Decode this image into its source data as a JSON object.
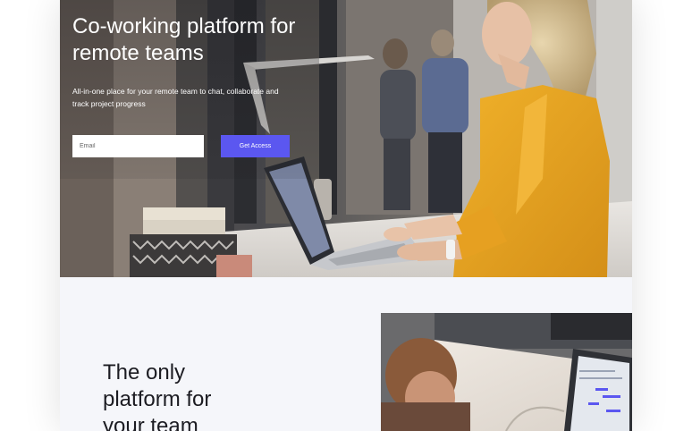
{
  "hero": {
    "title": "Co-working platform for remote teams",
    "subtitle": "All-in-one place for your remote team to chat, collaborate and track project progress",
    "email_placeholder": "Email",
    "cta_label": "Get Access"
  },
  "section2": {
    "title": "The only platform for your team"
  },
  "colors": {
    "accent": "#5b57f0",
    "hero_text": "#ffffff",
    "section_bg": "#f5f6fa",
    "jacket": "#e8a623"
  }
}
